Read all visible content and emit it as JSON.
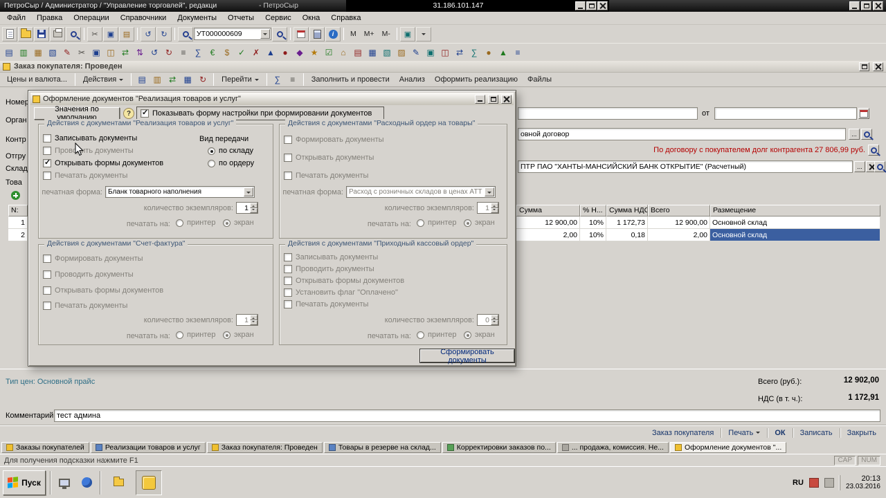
{
  "colors": {
    "base": "#d6d3ce",
    "selection": "#3b5fa0",
    "alert_red": "#b40000",
    "link_navy": "#17356b",
    "footer_teal": "#2e6e86"
  },
  "glyphs": {
    "cut": "✂",
    "copy": "▣",
    "paste": "▤",
    "undo": "↺",
    "redo": "↻",
    "ellipsis": "...",
    "question": "?",
    "info": "i"
  },
  "titlebar": {
    "app_title": "ПетроСыр / Администратор / \"Управление торговлей\", редакци",
    "session_fragment": "- ПетроСыр",
    "rdp_address": "31.186.101.147"
  },
  "menubar": {
    "items": [
      {
        "label": "Файл"
      },
      {
        "label": "Правка"
      },
      {
        "label": "Операции"
      },
      {
        "label": "Справочники"
      },
      {
        "label": "Документы"
      },
      {
        "label": "Отчеты"
      },
      {
        "label": "Сервис"
      },
      {
        "label": "Окна"
      },
      {
        "label": "Справка"
      }
    ]
  },
  "toolbar_main": {
    "search_value": "УТ000000609",
    "memory": [
      {
        "label": "M"
      },
      {
        "label": "M+"
      },
      {
        "label": "M-"
      }
    ]
  },
  "toolbar_icons": [
    {
      "g": "▤",
      "c": "c1"
    },
    {
      "g": "▥",
      "c": "c3"
    },
    {
      "g": "▦",
      "c": "c2"
    },
    {
      "g": "▧",
      "c": "c1"
    },
    {
      "g": "✎",
      "c": "c4"
    },
    {
      "g": "✂",
      "c": "c7"
    },
    {
      "g": "▣",
      "c": "c1"
    },
    {
      "g": "◫",
      "c": "c2"
    },
    {
      "g": "⇄",
      "c": "c3"
    },
    {
      "g": "⇅",
      "c": "c5"
    },
    {
      "g": "↺",
      "c": "c1"
    },
    {
      "g": "↻",
      "c": "c4"
    },
    {
      "g": "≡",
      "c": "c7"
    },
    {
      "g": "∑",
      "c": "c1"
    },
    {
      "g": "€",
      "c": "c3"
    },
    {
      "g": "$",
      "c": "c2"
    },
    {
      "g": "✓",
      "c": "c3"
    },
    {
      "g": "✗",
      "c": "c4"
    },
    {
      "g": "▲",
      "c": "c1"
    },
    {
      "g": "●",
      "c": "c4"
    },
    {
      "g": "◆",
      "c": "c5"
    },
    {
      "g": "★",
      "c": "c8"
    },
    {
      "g": "☑",
      "c": "c3"
    },
    {
      "g": "⌂",
      "c": "c2"
    },
    {
      "g": "▤",
      "c": "c4"
    },
    {
      "g": "▦",
      "c": "c1"
    },
    {
      "g": "▧",
      "c": "c6"
    },
    {
      "g": "▨",
      "c": "c2"
    },
    {
      "g": "✎",
      "c": "c1"
    },
    {
      "g": "▣",
      "c": "c6"
    },
    {
      "g": "◫",
      "c": "c4"
    },
    {
      "g": "⇄",
      "c": "c1"
    },
    {
      "g": "∑",
      "c": "c6"
    },
    {
      "g": "●",
      "c": "c2"
    },
    {
      "g": "▲",
      "c": "c3"
    },
    {
      "g": "≡",
      "c": "c1"
    }
  ],
  "doc_window": {
    "title": "Заказ покупателя: Проведен",
    "toolbar": {
      "prices_currency": "Цены и валюта...",
      "actions": "Действия",
      "goto": "Перейти",
      "fill_and_post": "Заполнить и провести",
      "analysis": "Анализ",
      "make_realization": "Оформить реализацию",
      "files": "Файлы",
      "icons1": [
        {
          "g": "▤",
          "c": "c1"
        },
        {
          "g": "▥",
          "c": "c2"
        },
        {
          "g": "⇄",
          "c": "c3"
        },
        {
          "g": "▦",
          "c": "c1"
        },
        {
          "g": "↻",
          "c": "c4"
        }
      ],
      "icons2": [
        {
          "g": "∑",
          "c": "c1"
        },
        {
          "g": "≡",
          "c": "c7"
        }
      ]
    },
    "form": {
      "left_labels": [
        "Номер",
        "Орган",
        "Контр",
        "Отгру",
        "Склад",
        "Това"
      ],
      "from_label": "от",
      "contract_fragment": "овной договор",
      "debt_warning": "По договору с покупателем долг контрагента 27 806,99 руб.",
      "account_value": "ПТР ПАО \"ХАНТЫ-МАНСИЙСКИЙ БАНК ОТКРЫТИЕ\" (Расчетный)",
      "row_header": "N:",
      "row_numbers": [
        "1",
        "2"
      ]
    },
    "table": {
      "headers": [
        "Сумма",
        "% Н...",
        "Сумма НДС",
        "Всего",
        "Размещение"
      ],
      "rows": [
        {
          "sum": "12 900,00",
          "vat_pct": "10%",
          "vat_sum": "1 172,73",
          "total": "12 900,00",
          "placement": "Основной склад"
        },
        {
          "sum": "2,00",
          "vat_pct": "10%",
          "vat_sum": "0,18",
          "total": "2,00",
          "placement": "Основной склад"
        }
      ]
    },
    "footer": {
      "price_type": "Тип цен: Основной прайс",
      "total_label": "Всего (руб.):",
      "total_value": "12 902,00",
      "vat_label": "НДС (в т. ч.):",
      "vat_value": "1 172,91",
      "comment_label": "Комментарий:",
      "comment_value": "тест админа",
      "order_button": "Заказ покупателя",
      "print_button": "Печать",
      "ok_button": "ОК",
      "save_button": "Записать",
      "close_button": "Закрыть"
    }
  },
  "dialog": {
    "title": "Оформление документов \"Реализация товаров и услуг\"",
    "defaults_button": "Значения по умолчанию",
    "show_settings_checkbox": "Показывать форму настройки при формировании документов",
    "submit_button": "Сформировать документы",
    "labels": {
      "print_form": "печатная форма:",
      "copies": "количество экземпляров:",
      "print_to": "печатать на:",
      "printer": "принтер",
      "screen": "экран"
    },
    "group_realization": {
      "title": "Действия с документами \"Реализация товаров и услуг\"",
      "cb_write": "Записывать документы",
      "cb_post": "Проводить документы",
      "cb_open": "Открывать формы документов",
      "cb_print": "Печатать документы",
      "transfer_label": "Вид передачи",
      "transfer_warehouse": "по складу",
      "transfer_order": "по ордеру",
      "print_form_value": "Бланк товарного наполнения",
      "copies_value": "1"
    },
    "group_expense": {
      "title": "Действия с документами \"Расходный ордер на товары\"",
      "cb_create": "Формировать документы",
      "cb_open": "Открывать документы",
      "cb_print": "Печатать документы",
      "print_form_value": "Расход с розничных складов в ценах АТТ",
      "copies_value": "1"
    },
    "group_invoice": {
      "title": "Действия с документами \"Счет-фактура\"",
      "cb_create": "Формировать документы",
      "cb_post": "Проводить документы",
      "cb_open": "Открывать формы документов",
      "cb_print": "Печатать документы",
      "copies_value": "1"
    },
    "group_cash": {
      "title": "Действия с документами \"Приходный кассовый ордер\"",
      "cb_write": "Записывать документы",
      "cb_post": "Проводить документы",
      "cb_open": "Открывать формы документов",
      "cb_paid": "Установить флаг \"Оплачено\"",
      "cb_print": "Печатать документы",
      "copies_value": "0"
    }
  },
  "tabs": [
    {
      "label": "Заказы покупателей",
      "c": "ti-yellow"
    },
    {
      "label": "Реализации товаров и услуг",
      "c": "ti-blue"
    },
    {
      "label": "Заказ покупателя: Проведен",
      "c": "ti-yellow"
    },
    {
      "label": "Товары в резерве на склад...",
      "c": "ti-blue"
    },
    {
      "label": "Корректировки заказов по...",
      "c": "ti-green"
    },
    {
      "label": "... продажа, комиссия. Не...",
      "c": "ti-gray"
    },
    {
      "label": "Оформление документов \"...",
      "c": "ti-yellow",
      "cls": "active"
    }
  ],
  "statusbar": {
    "hint": "Для получения подсказки нажмите F1",
    "cap": "CAP",
    "num": "NUM"
  },
  "taskbar": {
    "start_label": "Пуск",
    "lang": "RU",
    "time": "20:13",
    "date": "23.03.2016"
  }
}
